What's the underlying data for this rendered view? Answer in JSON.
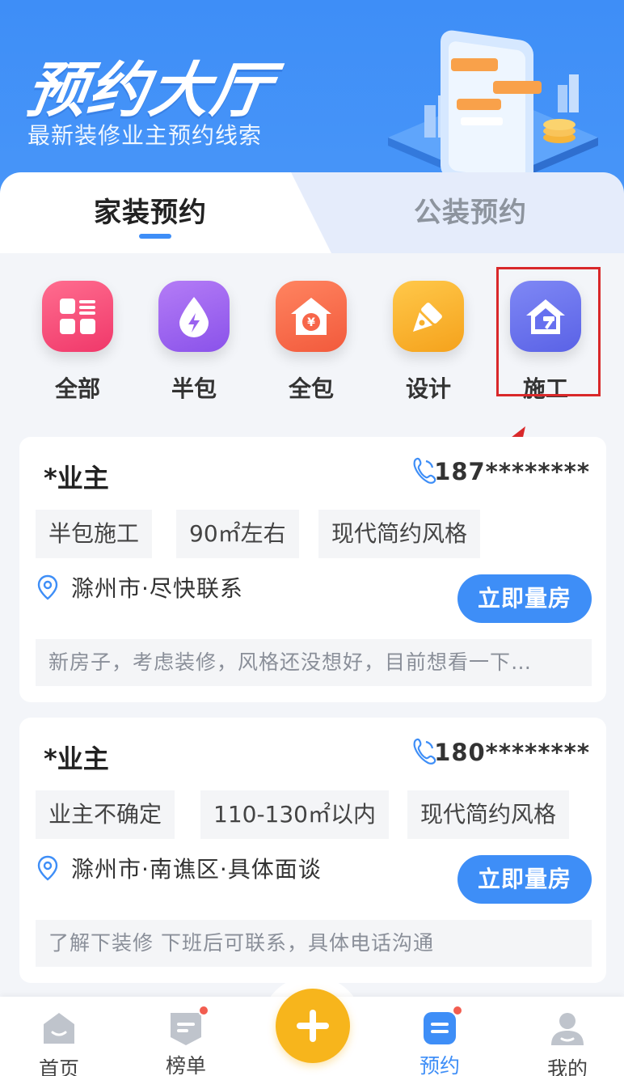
{
  "header": {
    "title": "预约大厅",
    "subtitle": "最新装修业主预约线索"
  },
  "tabs": {
    "home": "家装预约",
    "public": "公装预约",
    "active": "家装预约"
  },
  "categories": [
    {
      "label": "全部",
      "icon": "grid-list-icon",
      "color": "#f24d77"
    },
    {
      "label": "半包",
      "icon": "drop-lightning-icon",
      "color": "#9a62ef"
    },
    {
      "label": "全包",
      "icon": "house-yuan-icon",
      "color": "#f7664a"
    },
    {
      "label": "设计",
      "icon": "pen-ruler-icon",
      "color": "#f7b02c"
    },
    {
      "label": "施工",
      "icon": "house-hammer-icon",
      "color": "#6670ef"
    }
  ],
  "cards": [
    {
      "owner": "*业主",
      "phone": "187********",
      "chips": [
        "半包施工",
        "90㎡左右",
        "现代简约风格"
      ],
      "location": "滁州市·尽快联系",
      "cta": "立即量房",
      "note": "新房子，考虑装修，风格还没想好，目前想看一下…"
    },
    {
      "owner": "*业主",
      "phone": "180********",
      "chips": [
        "业主不确定",
        "110-130㎡以内",
        "现代简约风格"
      ],
      "location": "滁州市·南谯区·具体面谈",
      "cta": "立即量房",
      "note": "了解下装修 下班后可联系，具体电话沟通"
    }
  ],
  "nav": [
    {
      "label": "首页",
      "icon": "home-icon"
    },
    {
      "label": "榜单",
      "icon": "ranking-icon",
      "badge": true
    },
    {
      "label": "",
      "icon": "plus-icon"
    },
    {
      "label": "预约",
      "icon": "booking-icon",
      "badge": true,
      "active": true
    },
    {
      "label": "我的",
      "icon": "profile-icon"
    }
  ],
  "colors": {
    "primary": "#3e8ef7",
    "highlight_box": "#d9282a",
    "arrow": "#d9282a",
    "plus": "#f7b51c"
  }
}
